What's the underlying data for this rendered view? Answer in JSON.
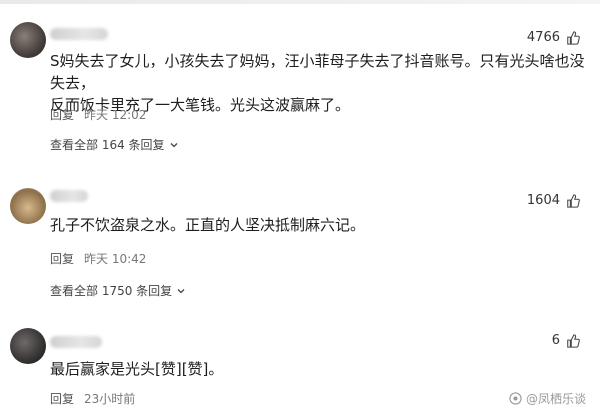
{
  "comments": [
    {
      "likes": "4766",
      "text_lines": [
        "S妈失去了女儿，小孩失去了妈妈，汪小菲母子失去了抖音账号。只有光头啥也没失去，",
        "反而饭卡里充了一大笔钱。光头这波赢麻了。"
      ],
      "reply_label": "回复",
      "time": "昨天 12:02",
      "expand_label": "查看全部 164 条回复"
    },
    {
      "likes": "1604",
      "text_lines": [
        "孔子不饮盗泉之水。正直的人坚决抵制麻六记。"
      ],
      "reply_label": "回复",
      "time": "昨天 10:42",
      "expand_label": "查看全部 1750 条回复"
    },
    {
      "likes": "6",
      "text_lines": [
        "最后赢家是光头[赞][赞]。"
      ],
      "reply_label": "回复",
      "time": "23小时前"
    }
  ],
  "watermark": "@凤栖乐谈"
}
